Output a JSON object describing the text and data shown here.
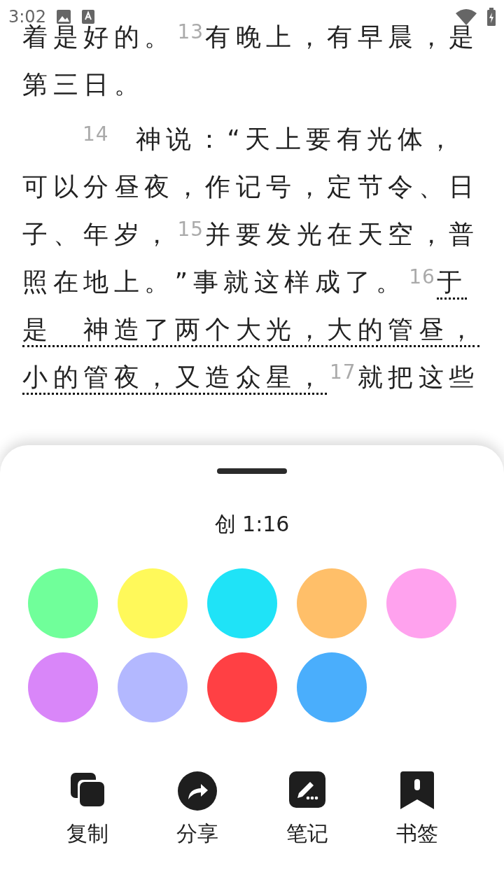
{
  "status_bar": {
    "time": "3:02"
  },
  "passage": [
    {
      "lines": [
        {
          "segments": [
            {
              "text": "着是好的。",
              "selected": false
            },
            {
              "num": "13",
              "text": "有晚上，有早晨，是",
              "selected": false
            }
          ]
        },
        {
          "segments": [
            {
              "text": "第三日。",
              "selected": false
            }
          ]
        }
      ]
    },
    {
      "lines": [
        {
          "segments": [
            {
              "num": "14",
              "text": "神说：“天上要有光体，",
              "selected": false
            }
          ]
        },
        {
          "segments": [
            {
              "text": "可以分昼夜，作记号，定节令、日",
              "selected": false
            }
          ]
        },
        {
          "segments": [
            {
              "text": "子、年岁，",
              "selected": false
            },
            {
              "num": "15",
              "text": "并要发光在天空，普",
              "selected": false
            }
          ]
        },
        {
          "segments": [
            {
              "text": "照在地上。”事就这样成了。",
              "selected": false
            },
            {
              "num": "16",
              "text": "于",
              "selected": true
            }
          ]
        },
        {
          "segments": [
            {
              "text": "是　神造了两个大光，大的管昼，",
              "selected": true
            }
          ]
        },
        {
          "segments": [
            {
              "text": "小的管夜，又造众星，",
              "selected": true
            },
            {
              "num": "17",
              "text": "就把这些",
              "selected": false
            }
          ]
        }
      ]
    }
  ],
  "sheet": {
    "reference": "创 1:16",
    "colors": [
      {
        "color": "#70ff9a"
      },
      {
        "color": "#fff95a"
      },
      {
        "color": "#1fe3f7"
      },
      {
        "color": "#ffbf69"
      },
      {
        "color": "#ffa2ee"
      },
      {
        "color": "#d986f9"
      },
      {
        "color": "#b3b8ff"
      },
      {
        "color": "#ff4044"
      },
      {
        "color": "#4aaefc"
      }
    ],
    "actions": [
      {
        "kind": "copy",
        "label": "复制"
      },
      {
        "kind": "share",
        "label": "分享"
      },
      {
        "kind": "note",
        "label": "笔记"
      },
      {
        "kind": "bookmark",
        "label": "书签"
      }
    ]
  }
}
